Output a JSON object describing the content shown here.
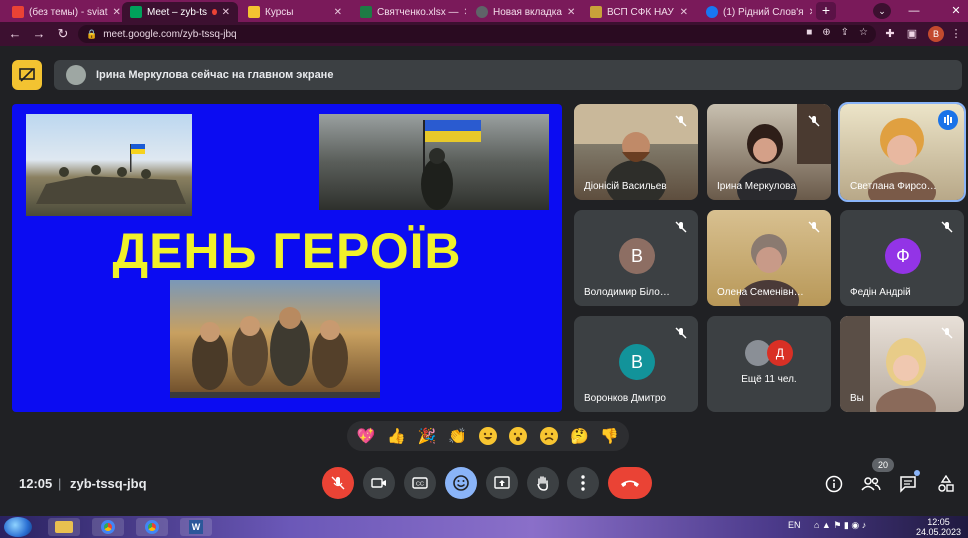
{
  "browser": {
    "tabs": [
      {
        "label": "(без темы) - sviat",
        "color": "#ea4335"
      },
      {
        "label": "Meet – zyb-ts",
        "color": "#00a15b"
      },
      {
        "label": "Курсы",
        "color": "#f3c331"
      },
      {
        "label": "Святченко.xlsx —",
        "color": "#1d7b45"
      },
      {
        "label": "Новая вкладка",
        "color": "#5f6368"
      },
      {
        "label": "ВСП СФК НАУ",
        "color": "#c8a23a"
      },
      {
        "label": "(1) Рідний Слов'я",
        "color": "#1877f2"
      }
    ],
    "url": "meet.google.com/zyb-tssq-jbq",
    "profile_initial": "B"
  },
  "meet": {
    "presenter_text": "Ірина Меркулова сейчас на главном экране",
    "slide_title": "ДЕНЬ ГЕРОЇВ",
    "tiles": [
      {
        "name": "Діонісій Васильев",
        "type": "video",
        "bg": "#6b5b4a"
      },
      {
        "name": "Ірина Меркулова",
        "type": "video",
        "bg": "#7a6a5a"
      },
      {
        "name": "Светлана Фирсо…",
        "type": "video",
        "bg": "#d8c89a"
      },
      {
        "name": "Володимир Біло…",
        "type": "avatar",
        "initial": "В",
        "color": "#8d6e63"
      },
      {
        "name": "Олена Семенівн…",
        "type": "video",
        "bg": "#c9a96a"
      },
      {
        "name": "Федін Андрій",
        "type": "avatar",
        "initial": "Ф",
        "color": "#9334e6"
      },
      {
        "name": "Воронков Дмитро",
        "type": "avatar",
        "initial": "В",
        "color": "#12939a"
      },
      {
        "name": "",
        "type": "more",
        "label": "Ещё 11 чел.",
        "initial": "Д"
      },
      {
        "name": "Вы",
        "type": "video",
        "bg": "#8a8a8a"
      }
    ],
    "reactions": [
      "sparkling-heart",
      "thumbs-up",
      "party-popper",
      "clapping-hands",
      "tears-of-joy",
      "surprised",
      "sad",
      "thinking",
      "thumbs-down"
    ],
    "clock": "12:05",
    "separator": "|",
    "meeting_code": "zyb-tssq-jbq",
    "participant_count": "20"
  },
  "taskbar": {
    "lang": "EN",
    "time": "12:05",
    "date": "24.05.2023"
  }
}
